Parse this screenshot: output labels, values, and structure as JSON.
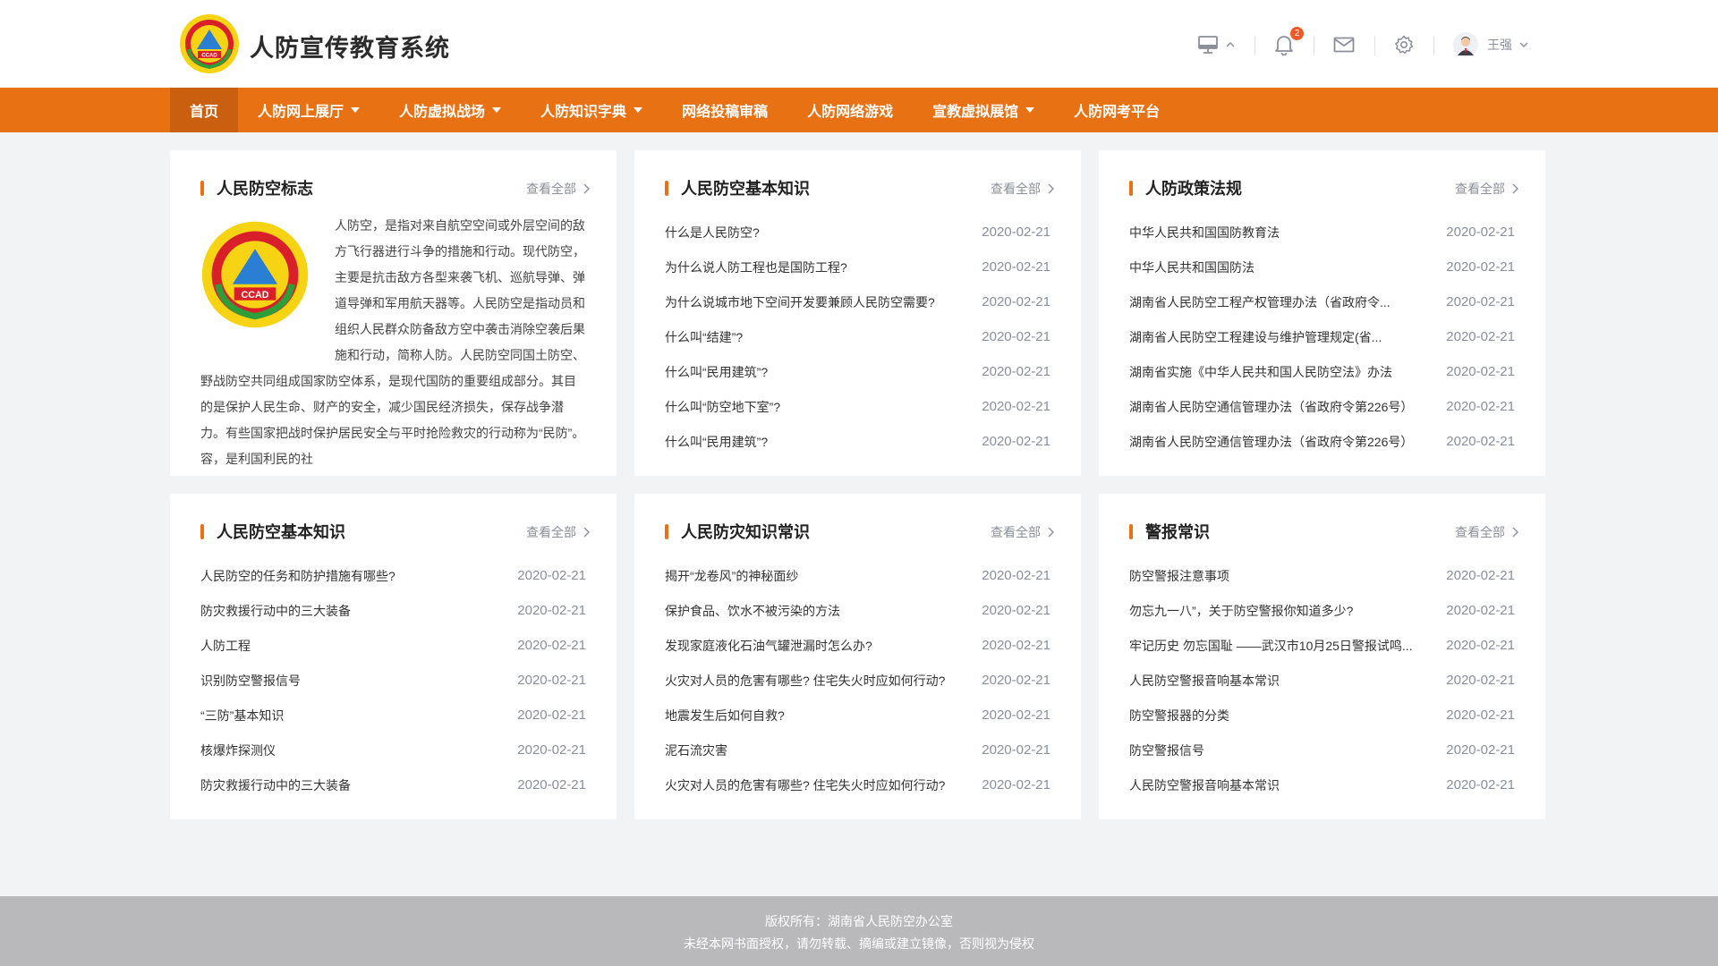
{
  "header": {
    "site_title": "人防宣传教育系统",
    "logo_text": "CCAD",
    "logo_ring_text": "中国人民防空",
    "notification_count": "2",
    "user_name": "王强"
  },
  "nav": {
    "items": [
      {
        "label": "首页",
        "active": true,
        "dropdown": false
      },
      {
        "label": "人防网上展厅",
        "active": false,
        "dropdown": true
      },
      {
        "label": "人防虚拟战场",
        "active": false,
        "dropdown": true
      },
      {
        "label": "人防知识字典",
        "active": false,
        "dropdown": true
      },
      {
        "label": "网络投稿审稿",
        "active": false,
        "dropdown": false
      },
      {
        "label": "人防网络游戏",
        "active": false,
        "dropdown": false
      },
      {
        "label": "宣教虚拟展馆",
        "active": false,
        "dropdown": true
      },
      {
        "label": "人防网考平台",
        "active": false,
        "dropdown": false
      }
    ]
  },
  "cards": {
    "c1": {
      "title": "人民防空标志",
      "more": "查看全部",
      "intro": "人防空，是指对来自航空空间或外层空间的敌方飞行器进行斗争的措施和行动。现代防空，主要是抗击敌方各型来袭飞机、巡航导弹、弹道导弹和军用航天器等。人民防空是指动员和组织人民群众防备敌方空中袭击消除空袭后果施和行动，简称人防。人民防空同国土防空、野战防空共同组成国家防空体系，是现代国防的重要组成部分。其目的是保护人民生命、财产的安全，减少国民经济损失，保存战争潜力。有些国家把战时保护居民安全与平时抢险救灾的行动称为“民防”。容，是利国利民的社"
    },
    "c2": {
      "title": "人民防空基本知识",
      "more": "查看全部",
      "items": [
        {
          "title": "什么是人民防空?",
          "date": "2020-02-21"
        },
        {
          "title": "为什么说人防工程也是国防工程?",
          "date": "2020-02-21"
        },
        {
          "title": "为什么说城市地下空间开发要兼顾人民防空需要?",
          "date": "2020-02-21"
        },
        {
          "title": "什么叫“结建”?",
          "date": "2020-02-21"
        },
        {
          "title": "什么叫“民用建筑”?",
          "date": "2020-02-21"
        },
        {
          "title": "什么叫“防空地下室”?",
          "date": "2020-02-21"
        },
        {
          "title": "什么叫“民用建筑”?",
          "date": "2020-02-21"
        }
      ]
    },
    "c3": {
      "title": "人防政策法规",
      "more": "查看全部",
      "items": [
        {
          "title": "中华人民共和国国防教育法",
          "date": "2020-02-21"
        },
        {
          "title": "中华人民共和国国防法",
          "date": "2020-02-21"
        },
        {
          "title": "湖南省人民防空工程产权管理办法（省政府令...",
          "date": "2020-02-21"
        },
        {
          "title": "湖南省人民防空工程建设与维护管理规定(省...",
          "date": "2020-02-21"
        },
        {
          "title": "湖南省实施《中华人民共和国人民防空法》办法",
          "date": "2020-02-21"
        },
        {
          "title": "湖南省人民防空通信管理办法（省政府令第226号）",
          "date": "2020-02-21"
        },
        {
          "title": "湖南省人民防空通信管理办法（省政府令第226号）",
          "date": "2020-02-21"
        }
      ]
    },
    "c4": {
      "title": "人民防空基本知识",
      "more": "查看全部",
      "items": [
        {
          "title": "人民防空的任务和防护措施有哪些?",
          "date": "2020-02-21"
        },
        {
          "title": "防灾救援行动中的三大装备",
          "date": "2020-02-21"
        },
        {
          "title": "人防工程",
          "date": "2020-02-21"
        },
        {
          "title": "识别防空警报信号",
          "date": "2020-02-21"
        },
        {
          "title": "“三防”基本知识",
          "date": "2020-02-21"
        },
        {
          "title": "核爆炸探测仪",
          "date": "2020-02-21"
        },
        {
          "title": "防灾救援行动中的三大装备",
          "date": "2020-02-21"
        }
      ]
    },
    "c5": {
      "title": "人民防灾知识常识",
      "more": "查看全部",
      "items": [
        {
          "title": "揭开“龙卷风”的神秘面纱",
          "date": "2020-02-21"
        },
        {
          "title": "保护食品、饮水不被污染的方法",
          "date": "2020-02-21"
        },
        {
          "title": "发现家庭液化石油气罐泄漏时怎么办?",
          "date": "2020-02-21"
        },
        {
          "title": "火灾对人员的危害有哪些? 住宅失火时应如何行动?",
          "date": "2020-02-21"
        },
        {
          "title": "地震发生后如何自救?",
          "date": "2020-02-21"
        },
        {
          "title": "泥石流灾害",
          "date": "2020-02-21"
        },
        {
          "title": "火灾对人员的危害有哪些? 住宅失火时应如何行动?",
          "date": "2020-02-21"
        }
      ]
    },
    "c6": {
      "title": "警报常识",
      "more": "查看全部",
      "items": [
        {
          "title": "防空警报注意事项",
          "date": "2020-02-21"
        },
        {
          "title": "勿忘九一八”，关于防空警报你知道多少?",
          "date": "2020-02-21"
        },
        {
          "title": "牢记历史 勿忘国耻 ——武汉市10月25日警报试鸣...",
          "date": "2020-02-21"
        },
        {
          "title": "人民防空警报音响基本常识",
          "date": "2020-02-21"
        },
        {
          "title": "防空警报器的分类",
          "date": "2020-02-21"
        },
        {
          "title": "防空警报信号",
          "date": "2020-02-21"
        },
        {
          "title": "人民防空警报音响基本常识",
          "date": "2020-02-21"
        }
      ]
    }
  },
  "footer": {
    "line1": "版权所有：湖南省人民防空办公室",
    "line2": "未经本网书面授权，请勿转载、摘编或建立镜像，否则视为侵权"
  },
  "colors": {
    "accent": "#e87114",
    "accent_dark": "#c95f0f",
    "footer_bg": "#b9b9bb",
    "page_bg": "#f2f3f5"
  }
}
